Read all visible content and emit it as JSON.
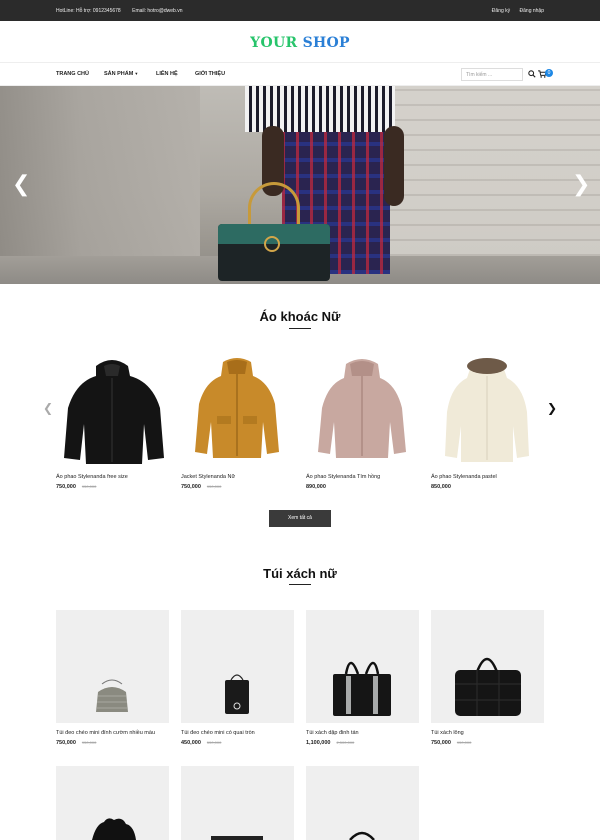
{
  "topbar": {
    "hotline": "HotLine: Hỗ trợ: 0912345678",
    "email": "Email: hotro@dweb.vn",
    "register": "Đăng ký",
    "login": "Đăng nhập"
  },
  "logo": {
    "word1": "YOUR",
    "word2": "SHOP"
  },
  "nav": {
    "items": [
      "TRANG CHỦ",
      "SẢN PHẨM",
      "LIÊN HỆ",
      "GIỚI THIỆU"
    ],
    "search_placeholder": "Tìm kiếm ...",
    "cart_count": "0"
  },
  "colors": {
    "logo_green": "#27c46b",
    "logo_blue": "#2a7fd6",
    "cart_badge": "#1e88e5",
    "button_dark": "#3a3a3a"
  },
  "section1": {
    "title": "Áo khoác Nữ",
    "products": [
      {
        "name": "Áo phao Stylenanda free size",
        "price": "750,000",
        "old_price": "950,000"
      },
      {
        "name": "Jacket Stylenanda Nữ",
        "price": "750,000",
        "old_price": "950,000"
      },
      {
        "name": "Áo phao Stylenanda Tím hồng",
        "price": "890,000",
        "old_price": ""
      },
      {
        "name": "Áo phao Stylenanda pastel",
        "price": "850,000",
        "old_price": ""
      }
    ],
    "view_all": "Xem tất cả"
  },
  "section2": {
    "title": "Túi xách nữ",
    "products": [
      {
        "name": "Túi đeo chéo mini đính cườm nhiều màu",
        "price": "750,000",
        "old_price": "950,000"
      },
      {
        "name": "Túi đeo chéo mini có quai tròn",
        "price": "450,000",
        "old_price": "550,000"
      },
      {
        "name": "Túi xách dập đinh tán",
        "price": "1,100,000",
        "old_price": "2,500,000"
      },
      {
        "name": "Túi xách lông",
        "price": "750,000",
        "old_price": "950,000"
      }
    ]
  }
}
